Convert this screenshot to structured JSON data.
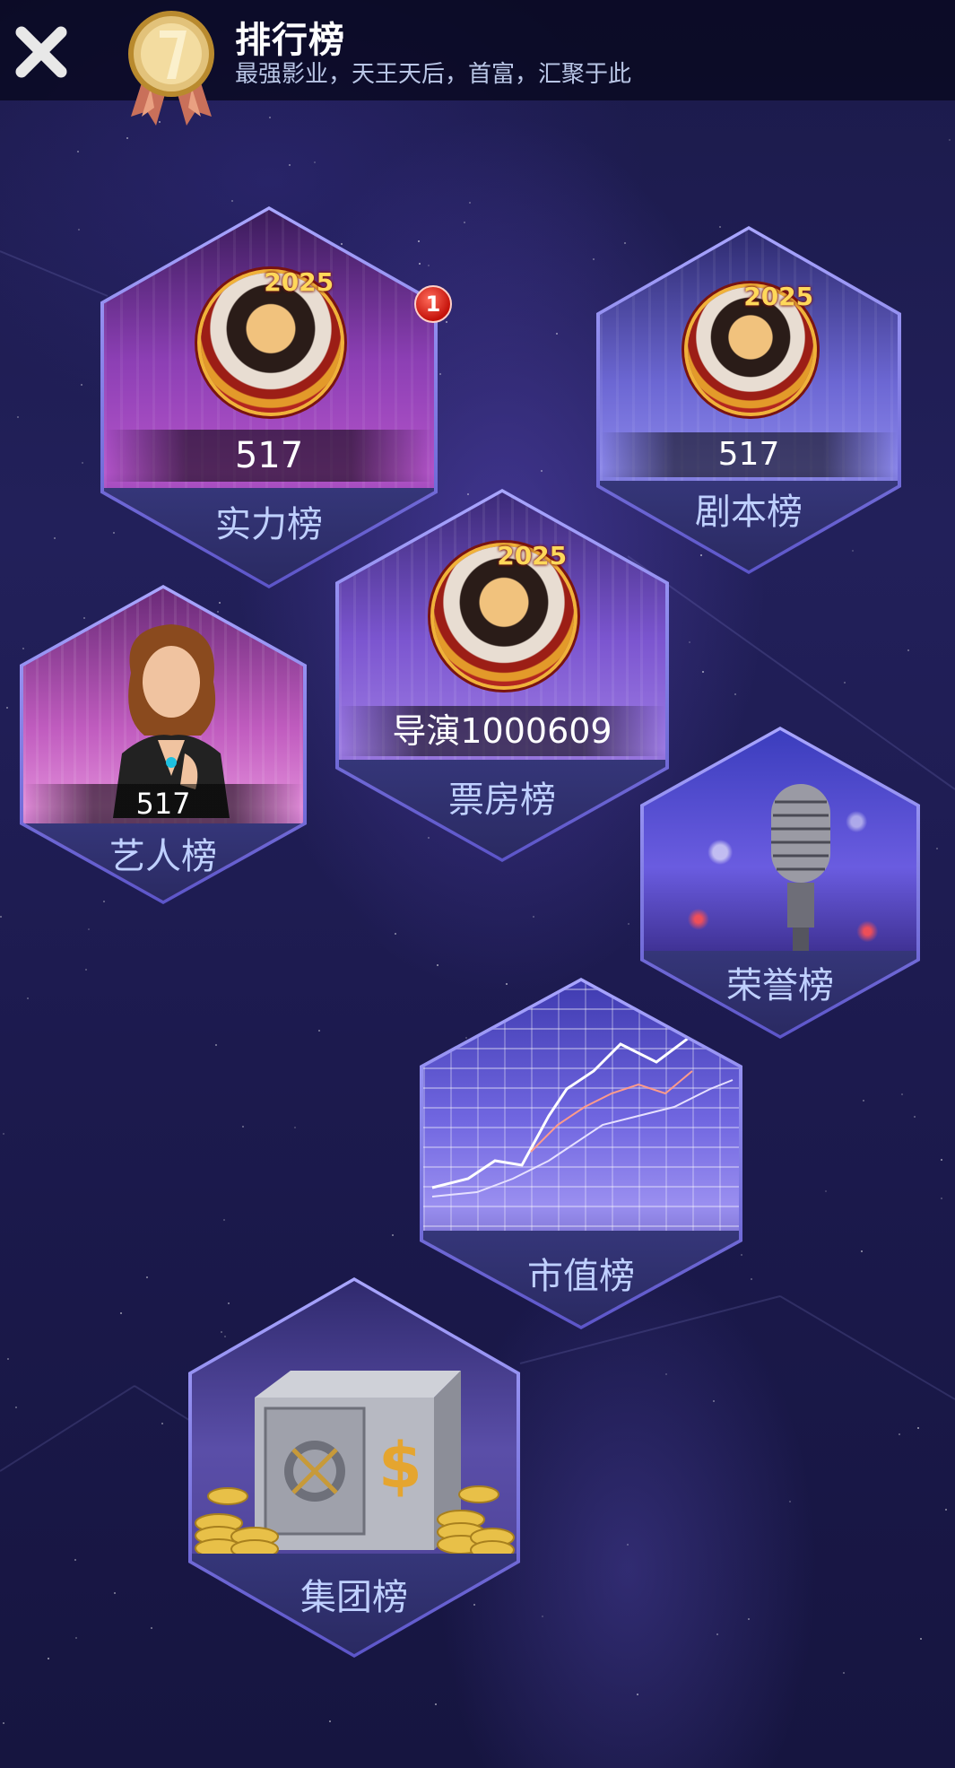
{
  "header": {
    "title": "排行榜",
    "subtitle": "最强影业，天王天后，首富，汇聚于此"
  },
  "icons": {
    "close": "close-icon",
    "medal": "medal-icon"
  },
  "tiles": {
    "strength": {
      "label": "实力榜",
      "value": "517",
      "avatar_year": "2025",
      "badge": "1"
    },
    "script": {
      "label": "剧本榜",
      "value": "517",
      "avatar_year": "2025"
    },
    "boxoffice": {
      "label": "票房榜",
      "value": "导演1000609",
      "avatar_year": "2025"
    },
    "artist": {
      "label": "艺人榜",
      "value": "517"
    },
    "honor": {
      "label": "荣誉榜"
    },
    "market": {
      "label": "市值榜"
    },
    "group": {
      "label": "集团榜"
    }
  },
  "colors": {
    "accent": "#bfd0ff",
    "badge": "#d8241a",
    "gold": "#f0b23a"
  }
}
